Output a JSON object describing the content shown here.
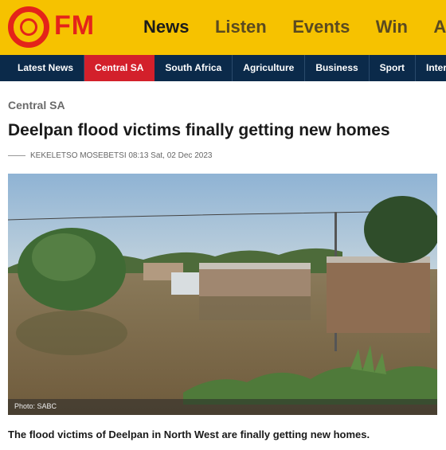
{
  "brand": {
    "logo_text": "FM",
    "accent": "#e4231a",
    "bar_color": "#f6c200"
  },
  "main_nav": [
    {
      "label": "News"
    },
    {
      "label": "Listen"
    },
    {
      "label": "Events"
    },
    {
      "label": "Win"
    },
    {
      "label": "Adv"
    }
  ],
  "sub_nav": [
    {
      "label": "Latest News"
    },
    {
      "label": "Central SA"
    },
    {
      "label": "South Africa"
    },
    {
      "label": "Agriculture"
    },
    {
      "label": "Business"
    },
    {
      "label": "Sport"
    },
    {
      "label": "Intern"
    }
  ],
  "article": {
    "category": "Central SA",
    "title": "Deelpan flood victims finally getting new homes",
    "byline": "KEKELETSO MOSEBETSI 08:13 Sat, 02 Dec 2023",
    "image_credit": "Photo: SABC",
    "summary": "The flood victims of Deelpan in North West are finally getting new homes."
  }
}
